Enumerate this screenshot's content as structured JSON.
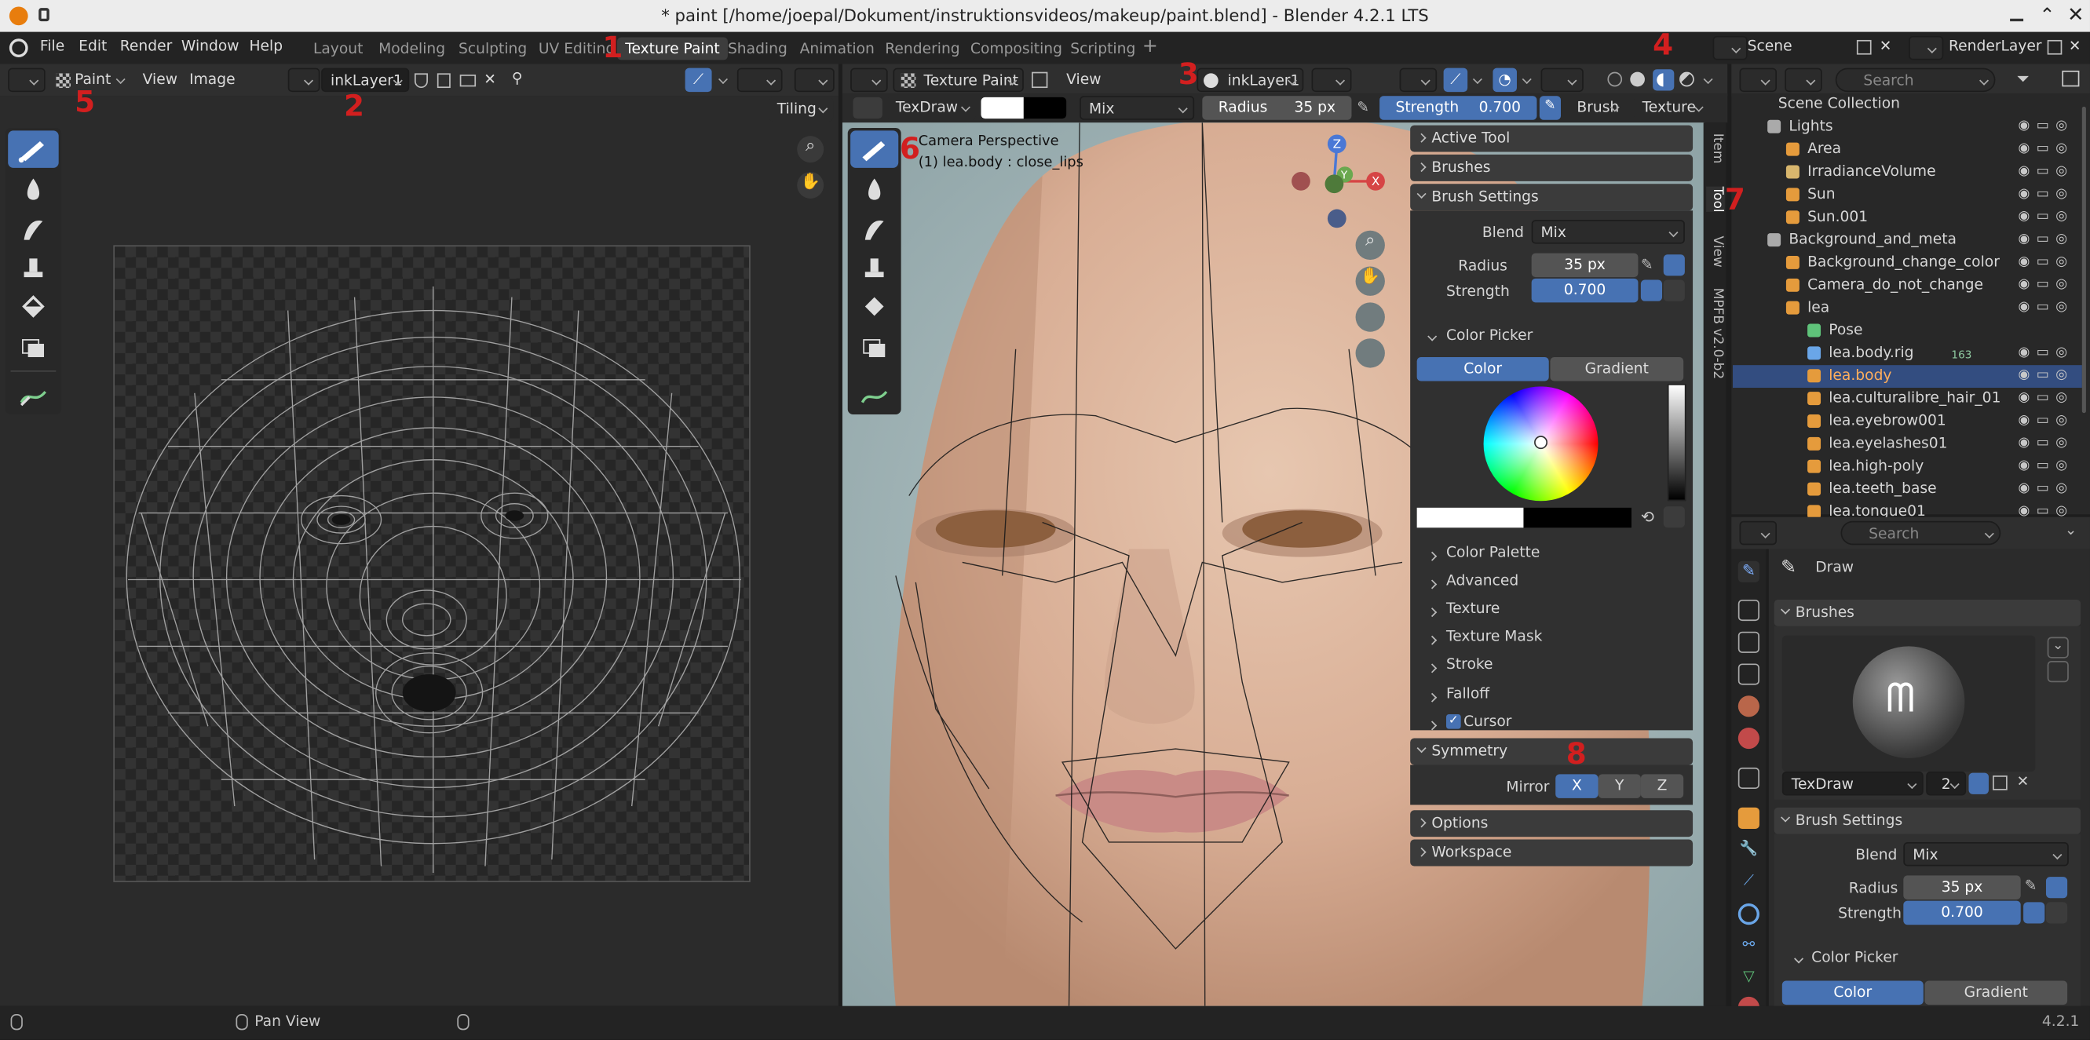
{
  "titlebar": {
    "title": "* paint [/home/joepal/Dokument/instruktionsvideos/makeup/paint.blend] - Blender 4.2.1 LTS"
  },
  "menu": [
    "File",
    "Edit",
    "Render",
    "Window",
    "Help"
  ],
  "workspaces": [
    "Layout",
    "Modeling",
    "Sculpting",
    "UV Editing",
    "Texture Paint",
    "Shading",
    "Animation",
    "Rendering",
    "Compositing",
    "Scripting"
  ],
  "active_workspace": "Texture Paint",
  "top_right": {
    "scene": "Scene",
    "render_layer": "RenderLayer"
  },
  "image_editor": {
    "mode": "Paint",
    "view": "View",
    "image": "Image",
    "image_name": "inkLayer1",
    "tiling": "Tiling"
  },
  "viewport": {
    "mode": "Texture Paint",
    "view": "View",
    "slot": "inkLayer1",
    "brush_name": "TexDraw",
    "blend": "Mix",
    "radius_label": "Radius",
    "radius": "35 px",
    "strength_label": "Strength",
    "strength": "0.700",
    "brush_menu": "Brush",
    "texture_menu": "Texture",
    "overlay_line1": "Camera Perspective",
    "overlay_line2": "(1) lea.body : close_lips"
  },
  "sidebar": {
    "tabs": [
      "Item",
      "Tool",
      "View",
      "MPFB v2.0-b2"
    ],
    "panels": {
      "active_tool": "Active Tool",
      "brushes": "Brushes",
      "brush_settings": "Brush Settings",
      "blend_label": "Blend",
      "blend": "Mix",
      "radius_label": "Radius",
      "radius": "35 px",
      "strength_label": "Strength",
      "strength": "0.700",
      "color_picker": "Color Picker",
      "color_tab": "Color",
      "gradient_tab": "Gradient",
      "subpanels": [
        "Color Palette",
        "Advanced",
        "Texture",
        "Texture Mask",
        "Stroke",
        "Falloff",
        "Cursor"
      ],
      "symmetry": "Symmetry",
      "mirror_label": "Mirror",
      "mirror_axes": [
        "X",
        "Y",
        "Z"
      ],
      "options": "Options",
      "workspace": "Workspace"
    }
  },
  "outliner": {
    "search_placeholder": "Search",
    "rows": [
      {
        "name": "Scene Collection"
      },
      {
        "name": "Lights"
      },
      {
        "name": "Area"
      },
      {
        "name": "IrradianceVolume"
      },
      {
        "name": "Sun"
      },
      {
        "name": "Sun.001"
      },
      {
        "name": "Background_and_meta"
      },
      {
        "name": "Background_change_color"
      },
      {
        "name": "Camera_do_not_change"
      },
      {
        "name": "lea"
      },
      {
        "name": "Pose"
      },
      {
        "name": "lea.body.rig",
        "badge": "163"
      },
      {
        "name": "lea.body",
        "selected": true
      },
      {
        "name": "lea.culturalibre_hair_01"
      },
      {
        "name": "lea.eyebrow001"
      },
      {
        "name": "lea.eyelashes01"
      },
      {
        "name": "lea.high-poly"
      },
      {
        "name": "lea.teeth_base"
      },
      {
        "name": "lea.tongue01"
      }
    ]
  },
  "properties": {
    "search_placeholder": "Search",
    "tool_name": "Draw",
    "brushes": "Brushes",
    "brush_name": "TexDraw",
    "brush_users": "2",
    "brush_settings": "Brush Settings",
    "blend_label": "Blend",
    "blend": "Mix",
    "radius_label": "Radius",
    "radius": "35 px",
    "strength_label": "Strength",
    "strength": "0.700",
    "color_picker": "Color Picker",
    "color_tab": "Color",
    "gradient_tab": "Gradient"
  },
  "statusbar": {
    "pan_view": "Pan View",
    "version": "4.2.1"
  },
  "markers": [
    "1",
    "2",
    "3",
    "4",
    "5",
    "6",
    "7",
    "8"
  ],
  "colors": {
    "accent": "#4772b3",
    "marker": "#d21f1f",
    "panel": "#303030",
    "header": "#2f2f2f"
  }
}
